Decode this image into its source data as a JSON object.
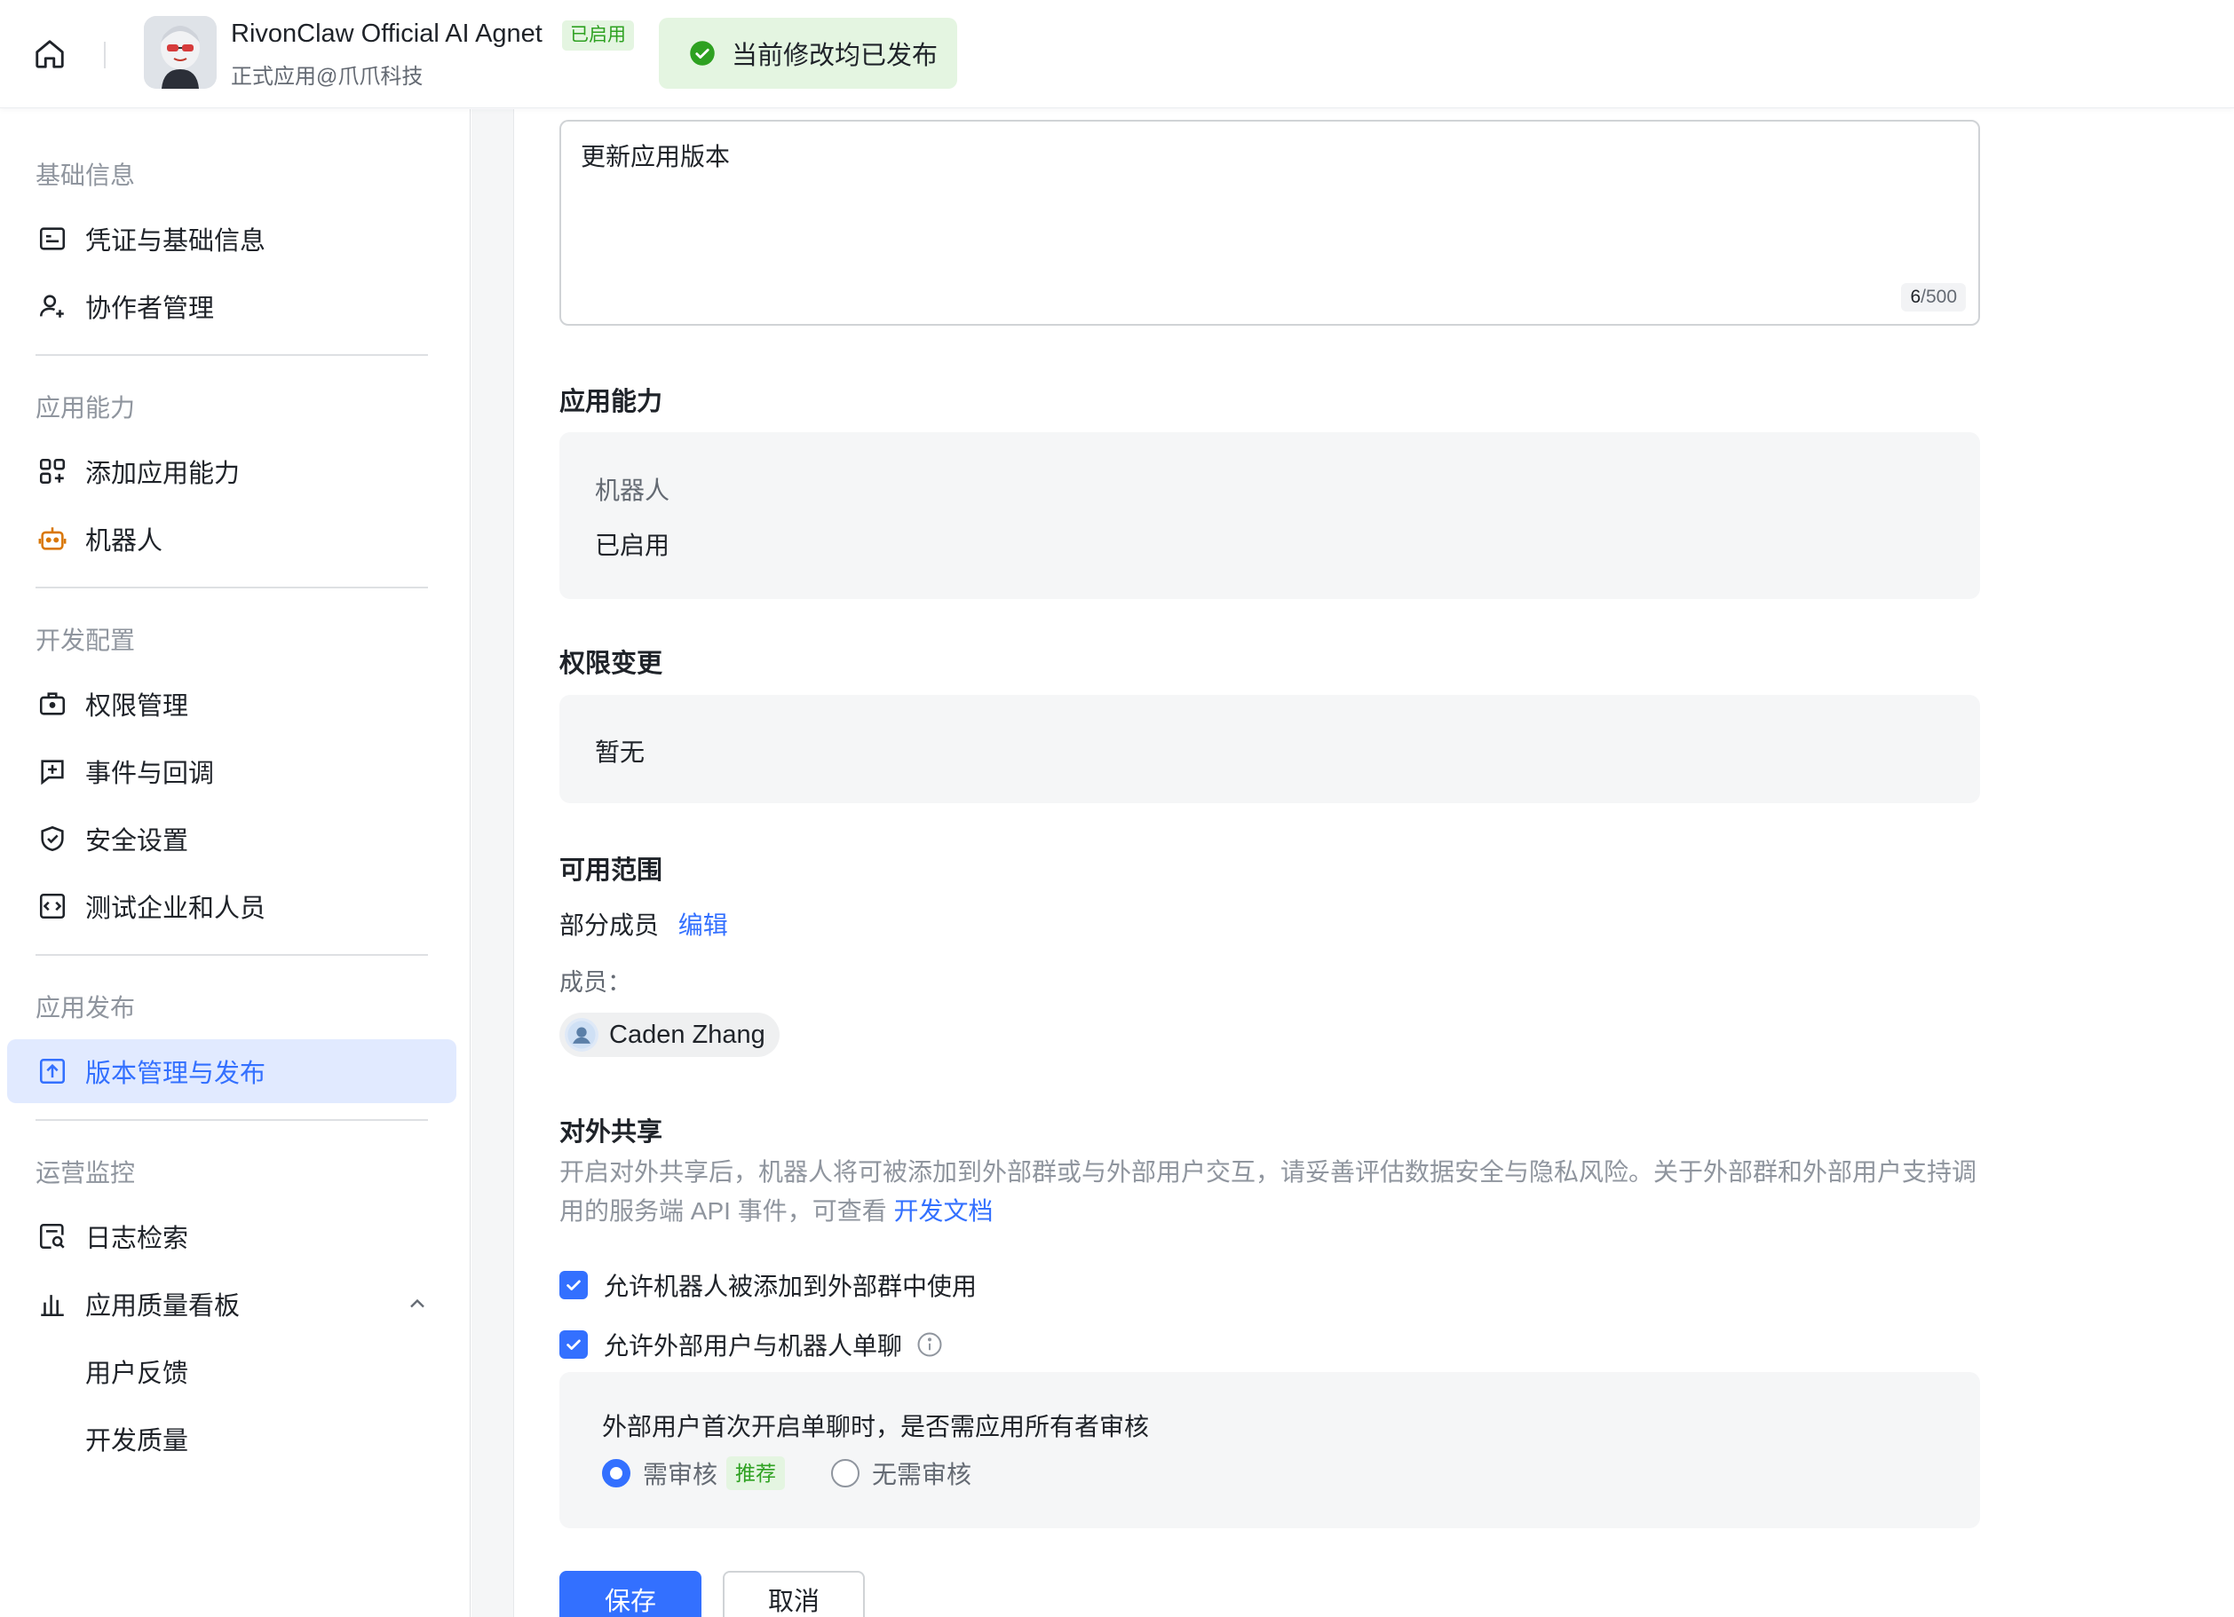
{
  "header": {
    "app_name": "RivonClaw Official AI Agnet",
    "status_badge": "已启用",
    "app_subtitle": "正式应用@爪爪科技",
    "toast": "当前修改均已发布"
  },
  "sidebar": {
    "groups": [
      {
        "title": "基础信息",
        "items": [
          {
            "label": "凭证与基础信息",
            "icon": "id-card-icon"
          },
          {
            "label": "协作者管理",
            "icon": "user-add-icon"
          }
        ]
      },
      {
        "title": "应用能力",
        "items": [
          {
            "label": "添加应用能力",
            "icon": "apps-add-icon"
          },
          {
            "label": "机器人",
            "icon": "robot-icon"
          }
        ]
      },
      {
        "title": "开发配置",
        "items": [
          {
            "label": "权限管理",
            "icon": "briefcase-lock-icon"
          },
          {
            "label": "事件与回调",
            "icon": "event-plus-icon"
          },
          {
            "label": "安全设置",
            "icon": "shield-check-icon"
          },
          {
            "label": "测试企业和人员",
            "icon": "code-box-icon"
          }
        ]
      },
      {
        "title": "应用发布",
        "items": [
          {
            "label": "版本管理与发布",
            "icon": "upload-box-icon",
            "active": true
          }
        ]
      },
      {
        "title": "运营监控",
        "items": [
          {
            "label": "日志检索",
            "icon": "log-search-icon"
          },
          {
            "label": "应用质量看板",
            "icon": "bar-chart-icon",
            "expanded": true
          }
        ]
      }
    ],
    "subitems": [
      "用户反馈",
      "开发质量"
    ]
  },
  "form": {
    "update_notes": "更新应用版本",
    "counter_current": "6",
    "counter_max": "/500",
    "capabilities": {
      "title": "应用能力",
      "name": "机器人",
      "status": "已启用"
    },
    "permissions": {
      "title": "权限变更",
      "value": "暂无"
    },
    "scope": {
      "title": "可用范围",
      "value": "部分成员",
      "edit": "编辑",
      "members_label": "成员：",
      "member": "Caden Zhang"
    },
    "sharing": {
      "title": "对外共享",
      "desc": "开启对外共享后，机器人将可被添加到外部群或与外部用户交互，请妥善评估数据安全与隐私风险。关于外部群和外部用户支持调用的服务端 API 事件，可查看",
      "doc_link": "开发文档",
      "option_group": "允许机器人被添加到外部群中使用",
      "option_chat": "允许外部用户与机器人单聊",
      "review_question": "外部用户首次开启单聊时，是否需应用所有者审核",
      "review_required": "需审核",
      "recommended": "推荐",
      "review_not_required": "无需审核"
    },
    "save": "保存",
    "cancel": "取消"
  },
  "colors": {
    "accent": "#3370ff",
    "success": "#2ea121",
    "success_bg": "#e4f5e1",
    "robot_icon": "#d97706"
  }
}
